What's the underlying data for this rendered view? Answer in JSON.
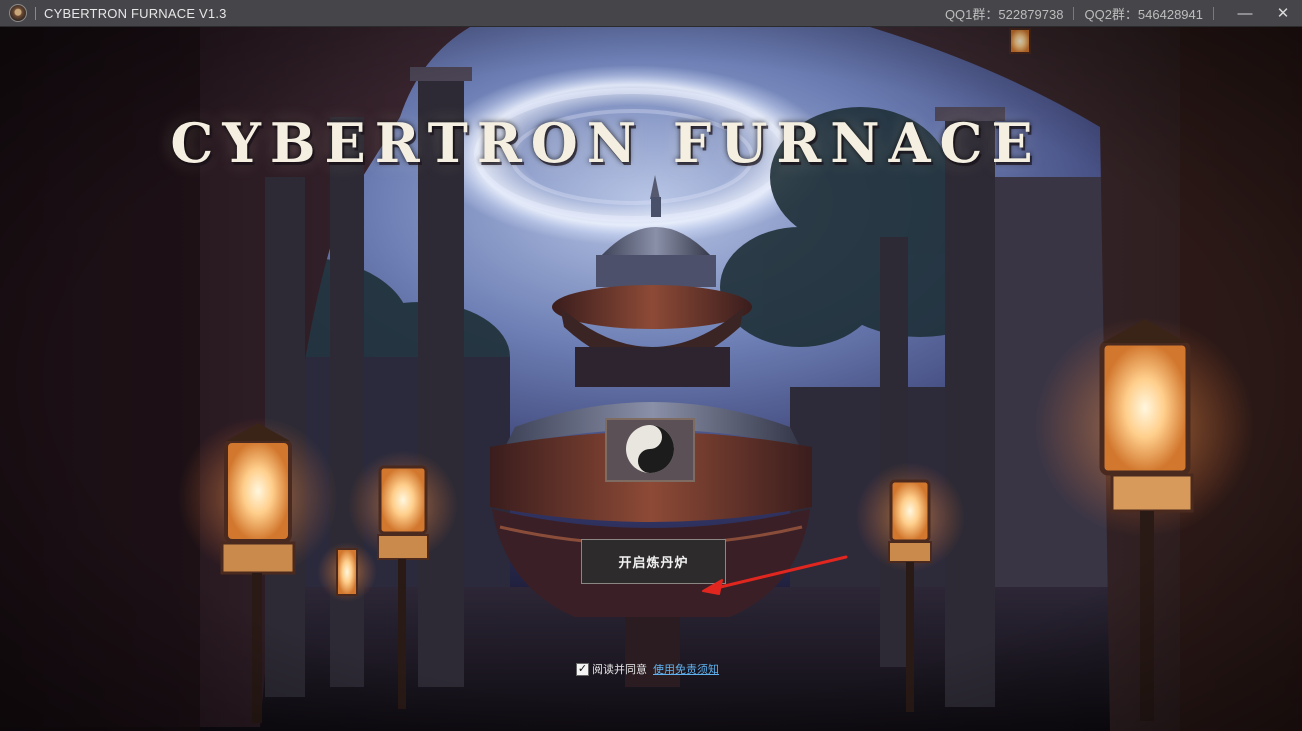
{
  "titlebar": {
    "app_title": "CYBERTRON FURNACE V1.3",
    "qq1": "QQ1群：522879738",
    "qq2": "QQ2群：546428941",
    "minimize_glyph": "—",
    "close_glyph": "✕"
  },
  "hero": {
    "title": "CYBERTRON FURNACE"
  },
  "start_button": {
    "label": "开启炼丹炉"
  },
  "agreement": {
    "checked": true,
    "check_glyph": "✓",
    "text": "阅读并同意",
    "link": "使用免责须知"
  },
  "colors": {
    "titlebar_bg": "#45454a",
    "link": "#5fb2ef",
    "arrow": "#e0261f",
    "button_bg": "#2e2b2c"
  },
  "icons": {
    "app_icon": "furnace-logo-icon",
    "minimize": "minimize-icon",
    "close": "close-icon",
    "checkbox": "checkmark-icon",
    "pointer": "red-arrow-icon"
  }
}
